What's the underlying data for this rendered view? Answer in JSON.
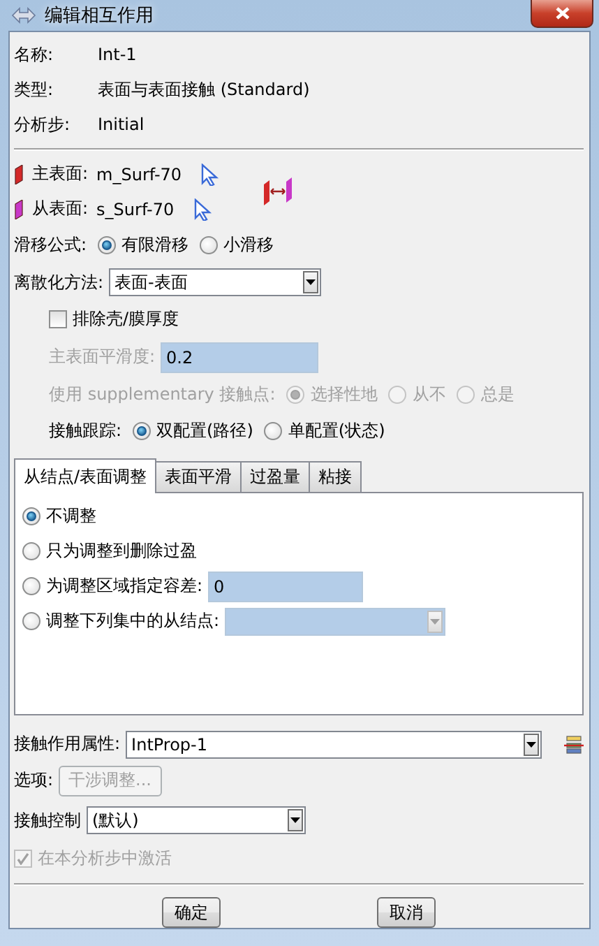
{
  "window": {
    "title": "编辑相互作用"
  },
  "info": [
    {
      "label": "名称:",
      "value": "Int-1"
    },
    {
      "label": "类型:",
      "value": "表面与表面接触 (Standard)"
    },
    {
      "label": "分析步:",
      "value": "Initial"
    }
  ],
  "surfaces": [
    {
      "label": "主表面:",
      "value": "m_Surf-70",
      "color": "#d42828"
    },
    {
      "label": "从表面:",
      "value": "s_Surf-70",
      "color": "#c838c8"
    }
  ],
  "sliding": {
    "label": "滑移公式:",
    "options": [
      {
        "label": "有限滑移",
        "selected": true
      },
      {
        "label": "小滑移",
        "selected": false
      }
    ]
  },
  "discretization": {
    "label": "离散化方法:",
    "value": "表面-表面"
  },
  "exclude_shell": {
    "label": "排除壳/膜厚度",
    "checked": false
  },
  "smoothing": {
    "label": "主表面平滑度:",
    "value": "0.2",
    "disabled": true
  },
  "supplementary": {
    "label": "使用 supplementary 接触点:",
    "disabled": true,
    "options": [
      {
        "label": "选择性地",
        "selected": true
      },
      {
        "label": "从不",
        "selected": false
      },
      {
        "label": "总是",
        "selected": false
      }
    ]
  },
  "tracking": {
    "label": "接触跟踪:",
    "options": [
      {
        "label": "双配置(路径)",
        "selected": true
      },
      {
        "label": "单配置(状态)",
        "selected": false
      }
    ]
  },
  "tabs": [
    {
      "label": "从结点/表面调整",
      "selected": true
    },
    {
      "label": "表面平滑",
      "selected": false
    },
    {
      "label": "过盈量",
      "selected": false
    },
    {
      "label": "粘接",
      "selected": false
    }
  ],
  "adjust_options": [
    {
      "kind": "plain",
      "label": "不调整",
      "selected": true
    },
    {
      "kind": "plain",
      "label": "只为调整到删除过盈",
      "selected": false
    },
    {
      "kind": "field",
      "label": "为调整区域指定容差:",
      "value": "0",
      "selected": false
    },
    {
      "kind": "dropdown",
      "label": "调整下列集中的从结点:",
      "selected": false
    }
  ],
  "property": {
    "label": "接触作用属性:",
    "value": "IntProp-1"
  },
  "options_row": {
    "label": "选项:",
    "button": "干涉调整...",
    "disabled": true
  },
  "control": {
    "label": "接触控制",
    "value": "(默认)"
  },
  "activate": {
    "label": "在本分析步中激活",
    "checked": true,
    "disabled": true
  },
  "buttons": [
    "确定",
    "取消"
  ]
}
